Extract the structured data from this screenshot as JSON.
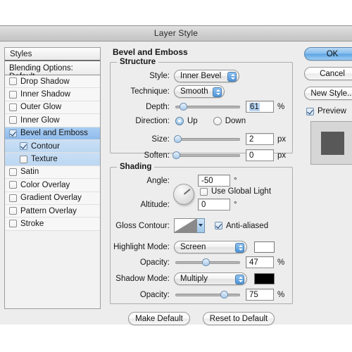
{
  "window": {
    "title": "Layer Style"
  },
  "styles_panel": {
    "header": "Styles",
    "blending_options": "Blending Options: Default",
    "items": [
      {
        "label": "Drop Shadow",
        "checked": false,
        "selected": false,
        "child": false
      },
      {
        "label": "Inner Shadow",
        "checked": false,
        "selected": false,
        "child": false
      },
      {
        "label": "Outer Glow",
        "checked": false,
        "selected": false,
        "child": false
      },
      {
        "label": "Inner Glow",
        "checked": false,
        "selected": false,
        "child": false
      },
      {
        "label": "Bevel and Emboss",
        "checked": true,
        "selected": true,
        "child": false
      },
      {
        "label": "Contour",
        "checked": true,
        "selected": false,
        "child": true
      },
      {
        "label": "Texture",
        "checked": false,
        "selected": false,
        "child": true
      },
      {
        "label": "Satin",
        "checked": false,
        "selected": false,
        "child": false
      },
      {
        "label": "Color Overlay",
        "checked": false,
        "selected": false,
        "child": false
      },
      {
        "label": "Gradient Overlay",
        "checked": false,
        "selected": false,
        "child": false
      },
      {
        "label": "Pattern Overlay",
        "checked": false,
        "selected": false,
        "child": false
      },
      {
        "label": "Stroke",
        "checked": false,
        "selected": false,
        "child": false
      }
    ]
  },
  "main": {
    "title": "Bevel and Emboss",
    "structure": {
      "legend": "Structure",
      "style_label": "Style:",
      "style_value": "Inner Bevel",
      "technique_label": "Technique:",
      "technique_value": "Smooth",
      "depth_label": "Depth:",
      "depth_value": "61",
      "depth_unit": "%",
      "depth_percent": 12,
      "direction_label": "Direction:",
      "direction_up": "Up",
      "direction_down": "Down",
      "direction_selected": "Up",
      "size_label": "Size:",
      "size_value": "2",
      "size_unit": "px",
      "size_percent": 4,
      "soften_label": "Soften:",
      "soften_value": "0",
      "soften_unit": "px",
      "soften_percent": 2
    },
    "shading": {
      "legend": "Shading",
      "angle_label": "Angle:",
      "angle_value": "-50",
      "angle_unit": "°",
      "use_global_light": "Use Global Light",
      "use_global_light_checked": false,
      "altitude_label": "Altitude:",
      "altitude_value": "0",
      "altitude_unit": "°",
      "gloss_contour_label": "Gloss Contour:",
      "anti_aliased": "Anti-aliased",
      "anti_aliased_checked": true,
      "highlight_mode_label": "Highlight Mode:",
      "highlight_mode_value": "Screen",
      "highlight_color": "#ffffff",
      "highlight_opacity_label": "Opacity:",
      "highlight_opacity_value": "47",
      "highlight_opacity_unit": "%",
      "highlight_opacity_percent": 47,
      "shadow_mode_label": "Shadow Mode:",
      "shadow_mode_value": "Multiply",
      "shadow_color": "#000000",
      "shadow_opacity_label": "Opacity:",
      "shadow_opacity_value": "75",
      "shadow_opacity_unit": "%",
      "shadow_opacity_percent": 75
    },
    "make_default": "Make Default",
    "reset_to_default": "Reset to Default"
  },
  "right_buttons": {
    "ok": "OK",
    "cancel": "Cancel",
    "new_style": "New Style...",
    "preview": "Preview",
    "preview_checked": true,
    "preview_color": "#585858"
  }
}
